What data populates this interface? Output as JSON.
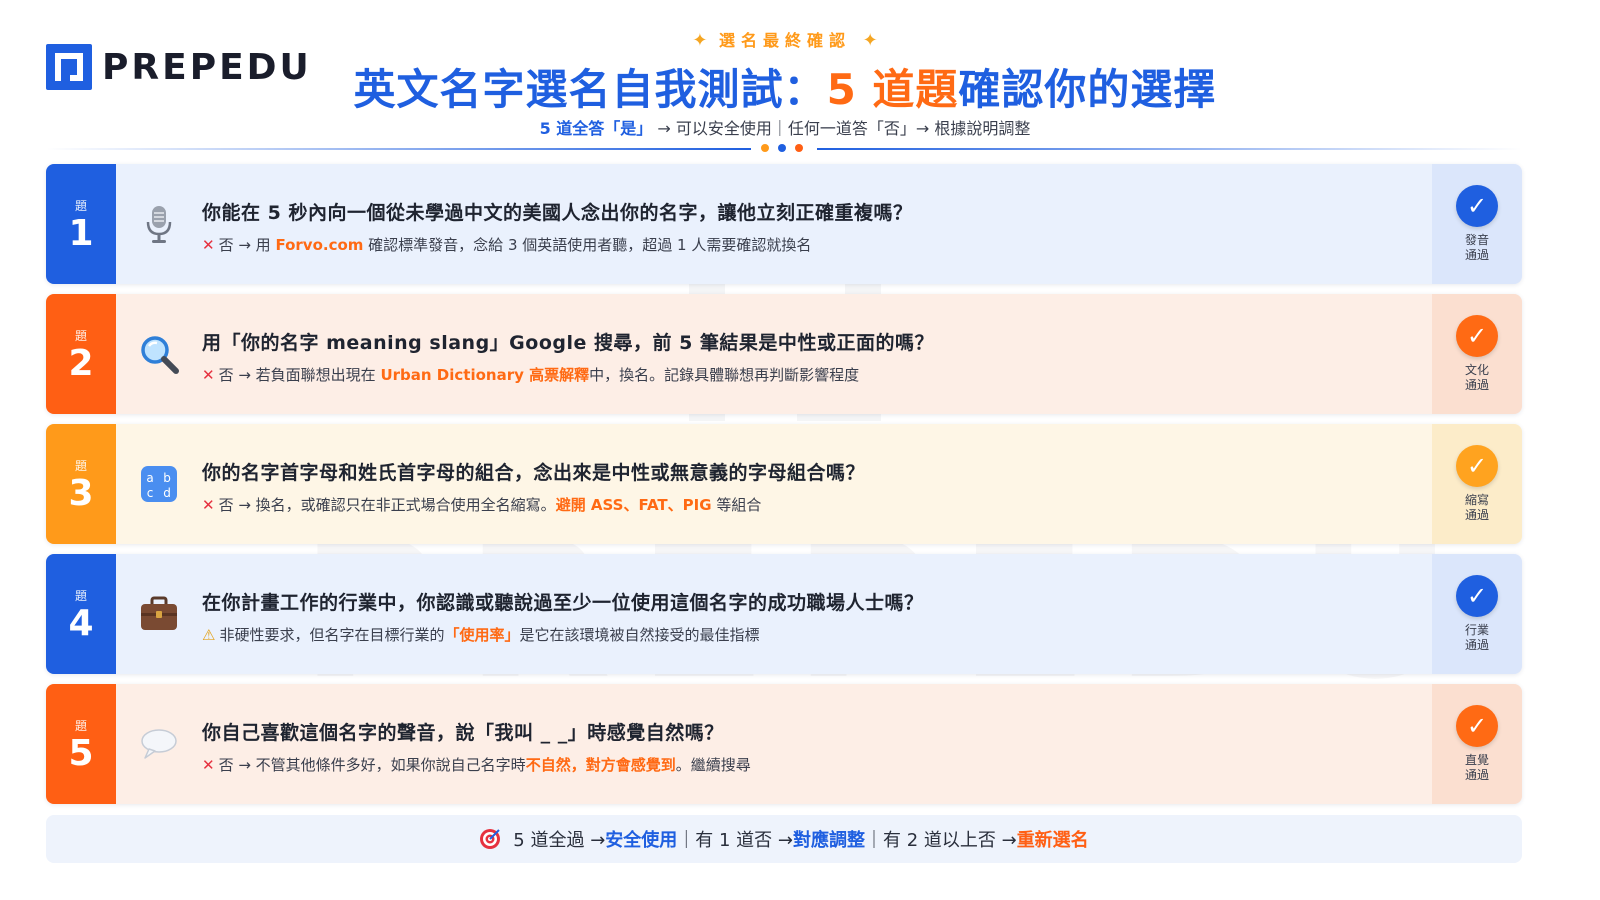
{
  "brand": {
    "name": "PREPEDU",
    "watermark": "PREPEDU"
  },
  "colors": {
    "blue": "#1f5fe0",
    "orange": "#ff5f14",
    "amber": "#ff9a1a",
    "red": "#e6313f"
  },
  "header": {
    "kicker_star_left": "✦",
    "kicker": "選名最終確認",
    "kicker_star_right": "✦",
    "title_part1": "英文名字選名自我測試：",
    "title_part2": "5 道題",
    "title_part3": "確認你的選擇",
    "subtitle_part1": "5 道全答「是」",
    "subtitle_part2": " → 可以安全使用｜任何一道答「否」→ 根據說明調整"
  },
  "rows": [
    {
      "num_label": "題",
      "num": "1",
      "icon": "microphone-icon",
      "question": "你能在 5 秒內向一個從未學過中文的美國人念出你的名字，讓他立刻正確重複嗎？",
      "answer_mark": "✕",
      "answer_pre": "否 → 用 ",
      "answer_hl": "Forvo.com",
      "answer_post": " 確認標準發音，念給 3 個英語使用者聽，超過 1 人需要確認就換名",
      "answer_hl2": "",
      "answer_post2": "",
      "status_icon": "✓",
      "status_label": "發音通過"
    },
    {
      "num_label": "題",
      "num": "2",
      "icon": "magnifier-icon",
      "question": "用「你的名字 meaning slang」Google 搜尋，前 5 筆結果是中性或正面的嗎？",
      "answer_mark": "✕",
      "answer_pre": "否 → 若負面聯想出現在 ",
      "answer_hl": "Urban Dictionary 高票解釋",
      "answer_post": "中，換名。記錄具體聯想再判斷影響程度",
      "answer_hl2": "",
      "answer_post2": "",
      "status_icon": "✓",
      "status_label": "文化通過"
    },
    {
      "num_label": "題",
      "num": "3",
      "icon": "abcd-icon",
      "question": "你的名字首字母和姓氏首字母的組合，念出來是中性或無意義的字母組合嗎？",
      "answer_mark": "✕",
      "answer_pre": "否 → 換名，或確認只在非正式場合使用全名縮寫。",
      "answer_hl": "避開 ASS、FAT、PIG",
      "answer_post": " 等組合",
      "answer_hl2": "",
      "answer_post2": "",
      "status_icon": "✓",
      "status_label": "縮寫通過"
    },
    {
      "num_label": "題",
      "num": "4",
      "icon": "briefcase-icon",
      "question": "在你計畫工作的行業中，你認識或聽說過至少一位使用這個名字的成功職場人士嗎？",
      "answer_mark": "⚠",
      "answer_pre": "非硬性要求，但名字在目標行業的",
      "answer_hl": "「使用率」",
      "answer_post": "是它在該環境被自然接受的最佳指標",
      "answer_hl2": "",
      "answer_post2": "",
      "status_icon": "✓",
      "status_label": "行業通過"
    },
    {
      "num_label": "題",
      "num": "5",
      "icon": "speech-bubble-icon",
      "question": "你自己喜歡這個名字的聲音，說「我叫 _ _」時感覺自然嗎？",
      "answer_mark": "✕",
      "answer_pre": "否 → 不管其他條件多好，如果你說自己名字時",
      "answer_hl": "不自然，對方會感覺到",
      "answer_post": "。繼續搜尋",
      "answer_hl2": "",
      "answer_post2": "",
      "status_icon": "✓",
      "status_label": "直覺通過"
    }
  ],
  "footer": {
    "icon": "target-icon",
    "p1": "5 道全過 → ",
    "p2": "安全使用",
    "p3": "｜有 1 道否 → ",
    "p4": "對應調整",
    "p5": "｜有 2 道以上否 → ",
    "p6": "重新選名"
  }
}
